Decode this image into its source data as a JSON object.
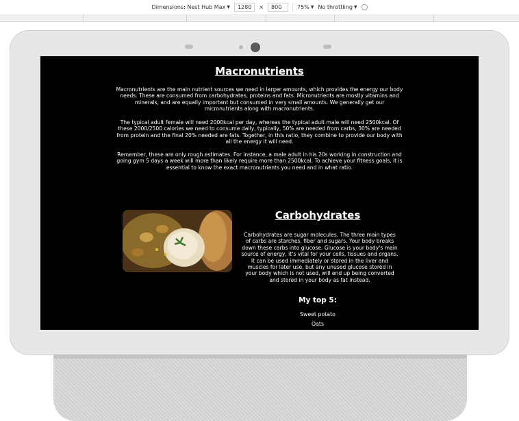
{
  "devtools": {
    "dimensions_label": "Dimensions: Nest Hub Max",
    "width": "1280",
    "times": "×",
    "height": "800",
    "zoom": "75%",
    "throttling": "No throttling"
  },
  "page": {
    "macro_title": "Macronutrients",
    "macro_p1": "Macronutrients are the main nutrient sources we need in larger amounts, which provides the energy our body needs. These are consumed from carbohydrates, proteins and fats. Micronutrients are mostly vitamins and minerals, and are equally important but consumed in very small amounts. We generally get our micronutrients along with macronutrients.",
    "macro_p2": "The typical adult female will need 2000kcal per day, whereas the typical adult male will need 2500kcal. Of these 2000/2500 calories we need to consume daily, typically, 50% are needed from carbs, 30% are needed from protein and the final 20% needed are fats. Together, in this ratio, they combine to provide our body with all the energy it will need.",
    "macro_p3": "Remember, these are only rough estimates. For instance, a male adult in his 20s working in construction and going gym 5 days a week will more than likely require more than 2500kcal. To achieve your fitness goals, it is essential to know the exact macronutrients you need and in what ratio.",
    "carb_title": "Carbohydrates",
    "carb_p": "Carbohydrates are sugar molecules. The three main types of carbs are starches, fiber and sugars. Your body breaks down these carbs into glucose. Glucose is your body's main source of energy, it's vital for your cells, tissues and organs. It can be used immediately or stored in the liver and muscles for later use, but any unused glucose stored in your body which is not used, will end up being converted and stored in your body as fat instead.",
    "top5_title": "My top 5:",
    "top5": [
      "Sweet potato",
      "Oats"
    ]
  }
}
